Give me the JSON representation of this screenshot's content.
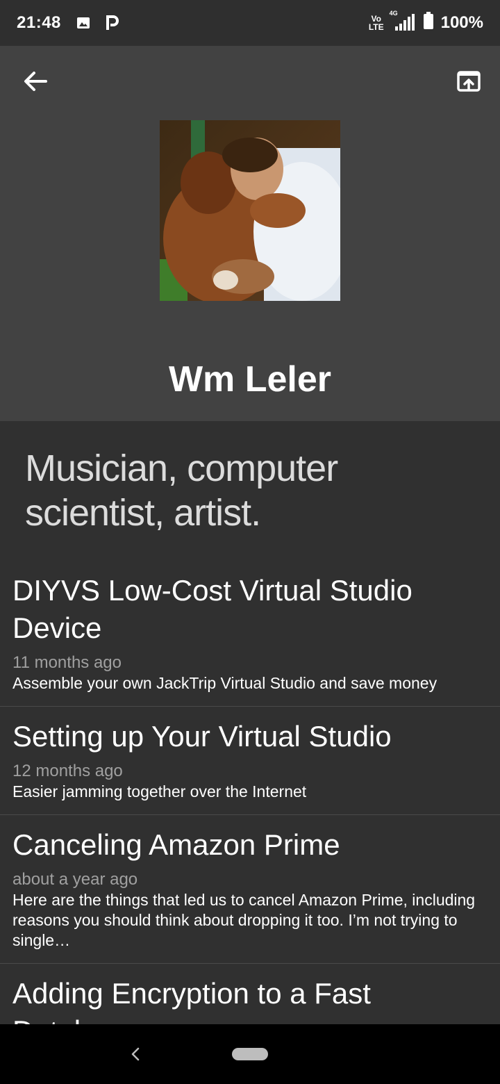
{
  "status_bar": {
    "time": "21:48",
    "network": "4G",
    "volte_top": "Vo",
    "volte_bottom": "LTE",
    "battery": "100%",
    "icons": [
      "image-icon",
      "parking-icon",
      "volte-icon",
      "signal-icon",
      "battery-icon"
    ]
  },
  "header": {
    "back_icon": "arrow-left-icon",
    "open_icon": "open-in-browser-icon",
    "name": "Wm Leler"
  },
  "bio": "Musician, computer scientist, artist.",
  "posts": [
    {
      "title": "DIYVS Low-Cost Virtual Studio Device",
      "date": "11 months ago",
      "excerpt": "Assemble your own JackTrip Virtual Studio and save money"
    },
    {
      "title": "Setting up Your Virtual Studio",
      "date": "12 months ago",
      "excerpt": "Easier jamming together over the Internet"
    },
    {
      "title": "Canceling Amazon Prime",
      "date": "about a year ago",
      "excerpt": "Here are the things that led us to cancel Amazon Prime, including reasons you should think about dropping it too. I’m not trying to single…"
    },
    {
      "title": "Adding Encryption to a Fast Database",
      "date": "",
      "excerpt": ""
    }
  ],
  "colors": {
    "header_bg": "#424242",
    "page_bg": "#303030",
    "status_bg": "#2f2f2f",
    "nav_bg": "#000000"
  }
}
